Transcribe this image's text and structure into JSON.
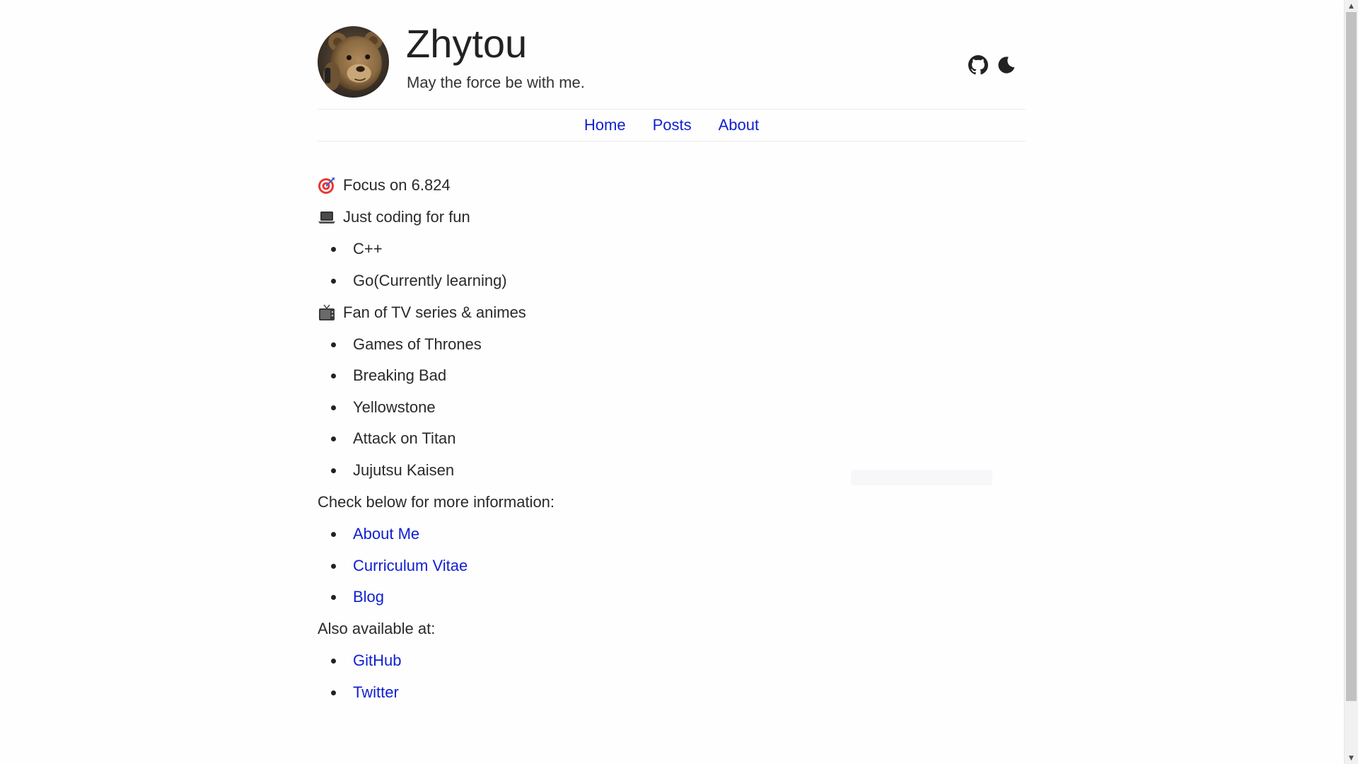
{
  "header": {
    "title": "Zhytou",
    "subtitle": "May the force be with me.",
    "avatar_icon": "teddy-bear-avatar",
    "icons": [
      "github-icon",
      "moon-icon"
    ]
  },
  "nav": {
    "items": [
      {
        "label": "Home"
      },
      {
        "label": "Posts"
      },
      {
        "label": "About"
      }
    ]
  },
  "content": {
    "focus": {
      "emoji": "target-icon",
      "text": "Focus on 6.824"
    },
    "coding": {
      "emoji": "laptop-icon",
      "text": "Just coding for fun",
      "items": [
        "C++",
        "Go(Currently learning)"
      ]
    },
    "tv": {
      "emoji": "tv-icon",
      "text": "Fan of TV series & animes",
      "items": [
        "Games of Thrones",
        "Breaking Bad",
        "Yellowstone",
        "Attack on Titan",
        "Jujutsu Kaisen"
      ]
    },
    "info": {
      "text": "Check below for more information:",
      "links": [
        "About Me",
        "Curriculum Vitae",
        "Blog"
      ]
    },
    "available": {
      "text": "Also available at:",
      "links": [
        "GitHub",
        "Twitter"
      ]
    }
  },
  "colors": {
    "link": "#0f1fd0",
    "text": "#2a2a2a",
    "background": "#fefefe"
  }
}
